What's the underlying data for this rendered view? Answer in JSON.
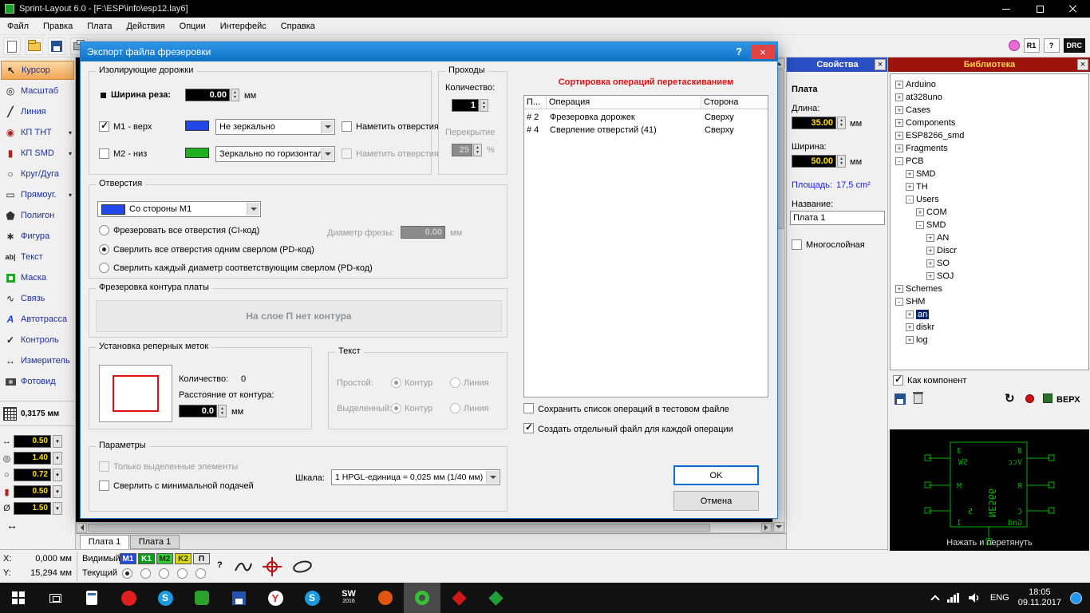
{
  "colors": {
    "dialog_title": "#1c83dc",
    "properties_title": "#2b4fc4",
    "library_title": "#9e120c",
    "selection_orange": "#f2a654",
    "hint_red": "#dd1111",
    "value_yellow": "#ffe000",
    "m1_blue": "#2247e8",
    "m2_green": "#1fb01f",
    "preview_green": "#00b400"
  },
  "window": {
    "title": "Sprint-Layout 6.0 - [F:\\ESP\\info\\esp12.lay6]"
  },
  "menu": {
    "items": [
      "Файл",
      "Правка",
      "Плата",
      "Действия",
      "Опции",
      "Интерфейс",
      "Справка"
    ]
  },
  "toolbar": {
    "r1": "R1",
    "help": "?",
    "drc": "DRC"
  },
  "tools": {
    "items": [
      "Курсор",
      "Масштаб",
      "Линия",
      "КП ТНТ",
      "КП SMD",
      "Круг/Дуга",
      "Прямоуг.",
      "Полигон",
      "Фигура",
      "Текст",
      "Маска",
      "Связь",
      "Автотрасса",
      "Контроль",
      "Измеритель",
      "Фотовид"
    ],
    "grid_value": "0,3175 мм",
    "values": [
      "0.50",
      "1.40",
      "0.72",
      "0.50",
      "1.50"
    ]
  },
  "dialog": {
    "title": "Экспорт файла фрезеровки",
    "help": "?",
    "isolation": {
      "legend": "Изолирующие дорожки",
      "cut_width_label": "Ширина реза:",
      "cut_width_value": "0.00",
      "mm": "мм",
      "m1_label": "M1 - верх",
      "m1_mirror": "Не зеркально",
      "m2_label": "M2 - низ",
      "m2_mirror": "Зеркально по горизонтали",
      "mark_holes": "Наметить отверстия"
    },
    "passes": {
      "legend": "Проходы",
      "count_label": "Количество:",
      "count_value": "1",
      "overlap_label": "Перекрытие",
      "overlap_value": "25",
      "percent": "%"
    },
    "sort_hint": "Сортировка операций перетаскиванием",
    "operations": {
      "col_num": "П...",
      "col_op": "Операция",
      "col_side": "Сторона",
      "rows": [
        {
          "num": "# 2",
          "op": "Фрезеровка дорожек",
          "side": "Сверху"
        },
        {
          "num": "# 4",
          "op": "Сверление отверстий (41)",
          "side": "Сверху"
        }
      ]
    },
    "holes": {
      "legend": "Отверстия",
      "side_value": "Со стороны M1",
      "mill_all": "Фрезеровать все отверстия (CI-код)",
      "drill_single": "Сверлить все отверстия одним сверлом (PD-код)",
      "drill_each": "Сверлить каждый диаметр соответствующим сверлом (PD-код)",
      "cutter_label": "Диаметр фрезы:",
      "cutter_value": "0.00",
      "mm": "мм"
    },
    "contour": {
      "legend": "Фрезеровка контура платы",
      "message": "На слое П нет контура"
    },
    "fiducials": {
      "legend": "Установка реперных меток",
      "count_label": "Количество:",
      "count_value": "0",
      "distance_label": "Расстояние от контура:",
      "distance_value": "0.0",
      "mm": "мм"
    },
    "text_group": {
      "legend": "Текст",
      "simple_label": "Простой:",
      "selected_label": "Выделенный:",
      "contour_label": "Контур",
      "line_label": "Линия"
    },
    "save_list_label": "Сохранить список операций в тестовом файле",
    "separate_files_label": "Создать отдельный файл для каждой операции",
    "params": {
      "legend": "Параметры",
      "only_selected": "Только выделенные элементы",
      "min_feed": "Сверлить с минимальной подачей",
      "scale_label": "Шкала:",
      "scale_value": "1 HPGL-единица = 0,025 мм (1/40 мм)"
    },
    "ok_label": "OK",
    "cancel_label": "Отмена"
  },
  "properties": {
    "title": "Свойства",
    "board": "Плата",
    "length_label": "Длина:",
    "length_value": "35.00",
    "width_label": "Ширина:",
    "width_value": "50.00",
    "mm": "мм",
    "area_label": "Площадь:",
    "area_value": "17,5 cm²",
    "name_label": "Название:",
    "name_value": "Плата 1",
    "multilayer": "Многослойная"
  },
  "library": {
    "title": "Библиотека",
    "tree": [
      {
        "label": "Arduino",
        "state": "+"
      },
      {
        "label": "at328uno",
        "state": "+"
      },
      {
        "label": "Cases",
        "state": "+"
      },
      {
        "label": "Components",
        "state": "+"
      },
      {
        "label": "ESP8266_smd",
        "state": "+"
      },
      {
        "label": "Fragments",
        "state": "+"
      },
      {
        "label": "PCB",
        "state": "-"
      },
      {
        "label": "SMD",
        "state": "+"
      },
      {
        "label": "TH",
        "state": "+"
      },
      {
        "label": "Users",
        "state": "-"
      },
      {
        "label": "COM",
        "state": "+"
      },
      {
        "label": "SMD",
        "state": "-"
      },
      {
        "label": "AN",
        "state": "+"
      },
      {
        "label": "Discr",
        "state": "+"
      },
      {
        "label": "SO",
        "state": "+"
      },
      {
        "label": "SOJ",
        "state": "+"
      },
      {
        "label": "Schemes",
        "state": "+"
      },
      {
        "label": "SHM",
        "state": "-"
      },
      {
        "label": "an",
        "state": "+"
      },
      {
        "label": "diskr",
        "state": "+"
      },
      {
        "label": "log",
        "state": "+"
      }
    ],
    "as_component": "Как компонент",
    "top_button": "ВЕРХ",
    "hint": "Нажать и перетянуть",
    "preview": {
      "chip": "NE566",
      "vcc": "Vcc",
      "sw": "SW",
      "r": "R",
      "c": "C",
      "gnd": "Gnd",
      "m": "М",
      "n8": "8",
      "n3": "3",
      "n5": "5",
      "n1": "1"
    }
  },
  "statusbar": {
    "x_label": "X:",
    "x_value": "0,000 мм",
    "y_label": "Y:",
    "y_value": "15,294 мм",
    "visible_label": "Видимый",
    "current_label": "Текущий",
    "help": "?",
    "layers": [
      {
        "label": "M1",
        "bg": "#2247e8",
        "fg": "#ffffff"
      },
      {
        "label": "K1",
        "bg": "#0e9c1e",
        "fg": "#ffffff"
      },
      {
        "label": "M2",
        "bg": "#35cb35",
        "fg": "#063806"
      },
      {
        "label": "K2",
        "bg": "#d8d81a",
        "fg": "#3c3c00"
      },
      {
        "label": "П",
        "bg": "#e6e6e6",
        "fg": "#000000"
      }
    ]
  },
  "tabs": {
    "items": [
      "Плата 1",
      "Плата 1"
    ]
  },
  "taskbar": {
    "apps": {
      "s_letter": "S",
      "y_letter": "Y",
      "sw": "SW",
      "sw_year": "2016"
    },
    "tray": {
      "lang": "ENG",
      "time": "18:05",
      "date": "09.11.2017"
    }
  }
}
